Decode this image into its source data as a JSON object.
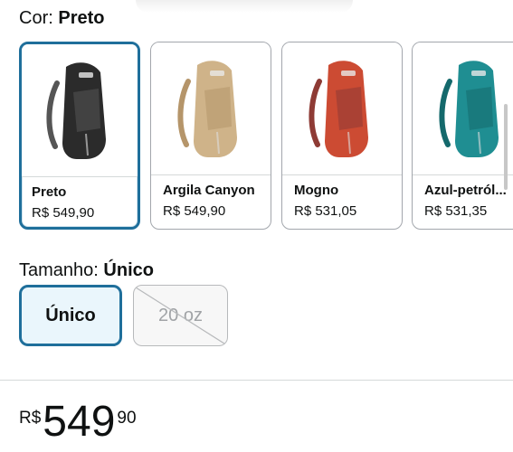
{
  "color": {
    "label": "Cor:",
    "value": "Preto"
  },
  "swatches": [
    {
      "name": "Preto",
      "price": "R$ 549,90",
      "color": "#2b2b2b",
      "accent": "#555555",
      "icon": "sling-backpack-icon"
    },
    {
      "name": "Argila Canyon",
      "price": "R$ 549,90",
      "color": "#cfb389",
      "accent": "#b5956a",
      "icon": "sling-backpack-icon"
    },
    {
      "name": "Mogno",
      "price": "R$ 531,05",
      "color": "#cc4b33",
      "accent": "#8e3b35",
      "icon": "sling-backpack-icon"
    },
    {
      "name": "Azul-petról...",
      "price": "R$ 531,35",
      "color": "#1f8e92",
      "accent": "#14696c",
      "icon": "sling-backpack-icon"
    }
  ],
  "size": {
    "label": "Tamanho:",
    "value": "Único",
    "options": [
      {
        "label": "Único"
      },
      {
        "label": "20 oz"
      }
    ]
  },
  "price": {
    "symbol": "R$",
    "whole": "549",
    "fraction": "90"
  }
}
